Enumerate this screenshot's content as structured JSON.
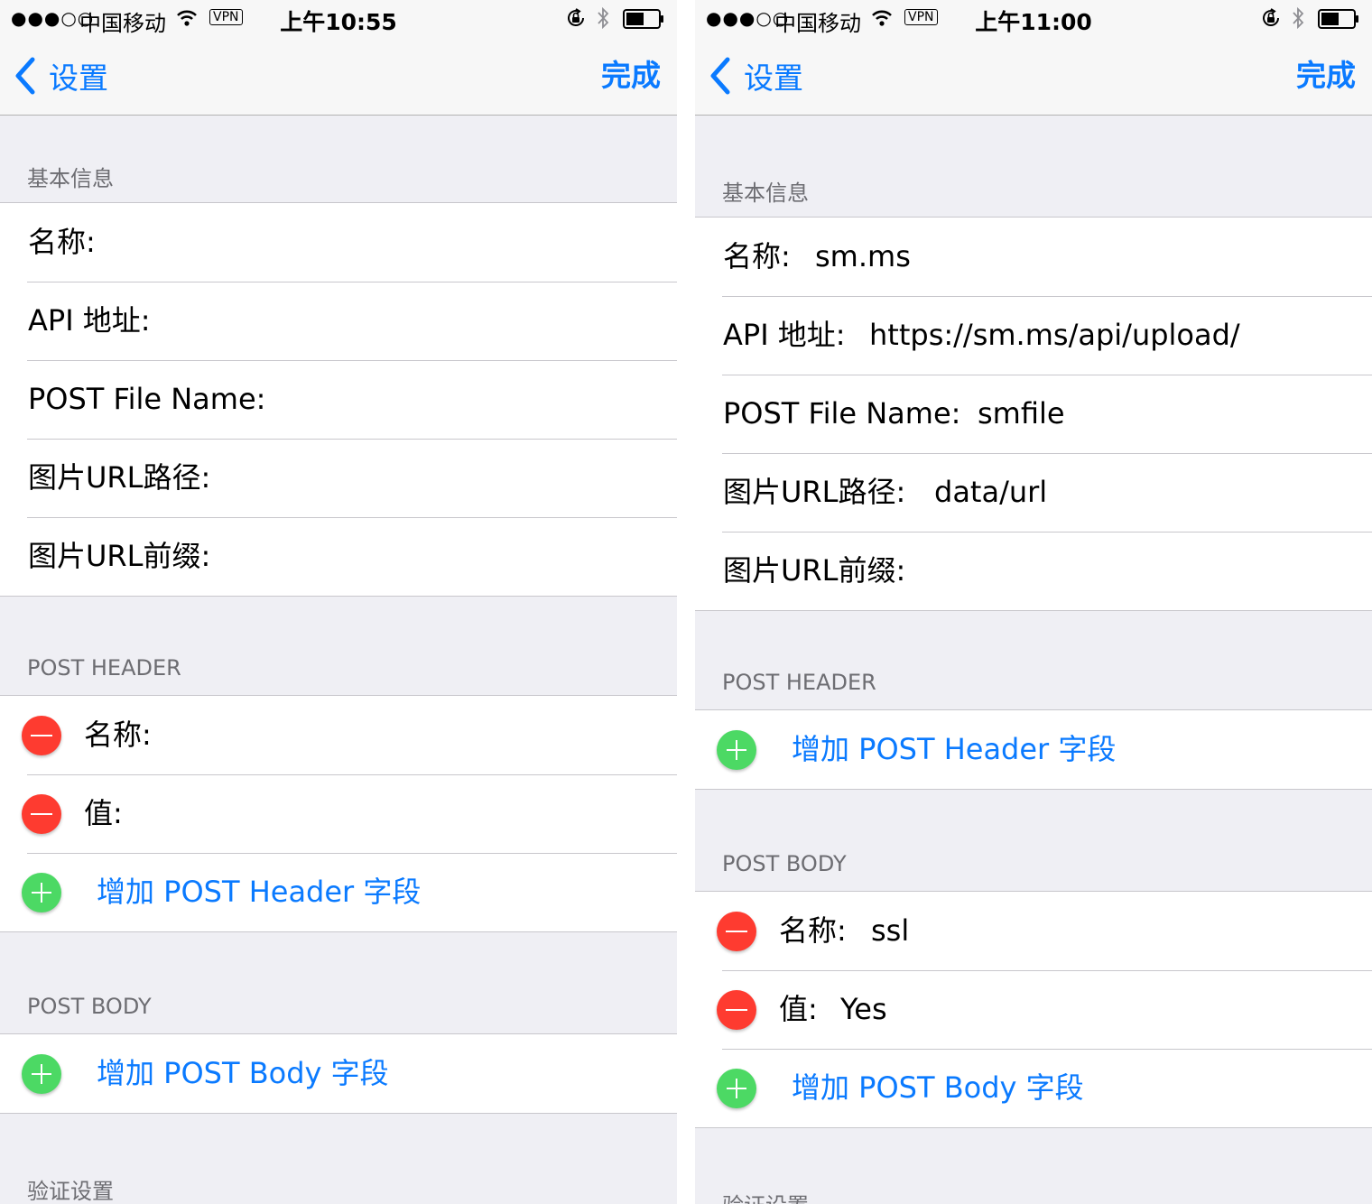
{
  "left": {
    "status": {
      "signal": "●●●○○",
      "carrier": "中国移动",
      "vpn": "VPN",
      "time": "上午10:55"
    },
    "nav": {
      "back_label": "设置",
      "done_label": "完成"
    },
    "basic": {
      "header": "基本信息",
      "rows": [
        {
          "label": "名称:",
          "value": ""
        },
        {
          "label": "API 地址:",
          "value": ""
        },
        {
          "label": "POST File Name:",
          "value": ""
        },
        {
          "label": "图片URL路径:",
          "value": ""
        },
        {
          "label": "图片URL前缀:",
          "value": ""
        }
      ]
    },
    "post_header": {
      "header": "POST HEADER",
      "rows": [
        {
          "label": "名称:",
          "value": ""
        },
        {
          "label": "值:",
          "value": ""
        }
      ],
      "add_label": "增加 POST Header 字段"
    },
    "post_body": {
      "header": "POST BODY",
      "add_label": "增加 POST Body 字段"
    },
    "verify": {
      "header": "验证设置"
    }
  },
  "right": {
    "status": {
      "signal": "●●●○○",
      "carrier": "中国移动",
      "vpn": "VPN",
      "time": "上午11:00"
    },
    "nav": {
      "back_label": "设置",
      "done_label": "完成"
    },
    "basic": {
      "header": "基本信息",
      "rows": [
        {
          "label": "名称:",
          "value": "sm.ms"
        },
        {
          "label": "API 地址:",
          "value": "https://sm.ms/api/upload/"
        },
        {
          "label": "POST File Name:",
          "value": "smfile"
        },
        {
          "label": "图片URL路径:",
          "value": "data/url"
        },
        {
          "label": "图片URL前缀:",
          "value": ""
        }
      ]
    },
    "post_header": {
      "header": "POST HEADER",
      "add_label": "增加 POST Header 字段"
    },
    "post_body": {
      "header": "POST BODY",
      "rows": [
        {
          "label": "名称:",
          "value": "ssl"
        },
        {
          "label": "值:",
          "value": "Yes"
        }
      ],
      "add_label": "增加 POST Body 字段"
    },
    "verify": {
      "header": "验证设置"
    }
  },
  "colors": {
    "accent": "#0a7aff",
    "delete": "#fe3b30",
    "add": "#4cd964",
    "background": "#efeff4",
    "section_text": "#6d6d72"
  },
  "icons": [
    "signal-dots-icon",
    "wifi-icon",
    "vpn-badge-icon",
    "rotation-lock-icon",
    "bluetooth-icon",
    "battery-icon",
    "chevron-left-icon",
    "minus-circle-icon",
    "plus-circle-icon"
  ]
}
